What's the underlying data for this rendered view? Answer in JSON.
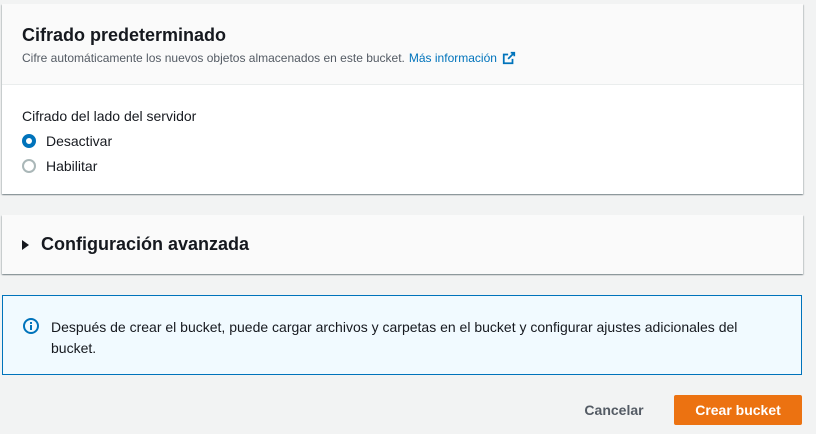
{
  "encryption": {
    "title": "Cifrado predeterminado",
    "description": "Cifre automáticamente los nuevos objetos almacenados en este bucket.",
    "info_link": "Más información",
    "field_label": "Cifrado del lado del servidor",
    "options": [
      {
        "label": "Desactivar",
        "selected": true
      },
      {
        "label": "Habilitar",
        "selected": false
      }
    ]
  },
  "advanced": {
    "title": "Configuración avanzada",
    "expanded": false
  },
  "alert": {
    "icon": "info-icon",
    "text": "Después de crear el bucket, puede cargar archivos y carpetas en el bucket y configurar ajustes adicionales del bucket."
  },
  "actions": {
    "cancel_label": "Cancelar",
    "create_label": "Crear bucket"
  },
  "colors": {
    "primary_button": "#ec7211",
    "link": "#0073bb",
    "alert_border": "#0073bb",
    "alert_bg": "#f1faff"
  }
}
